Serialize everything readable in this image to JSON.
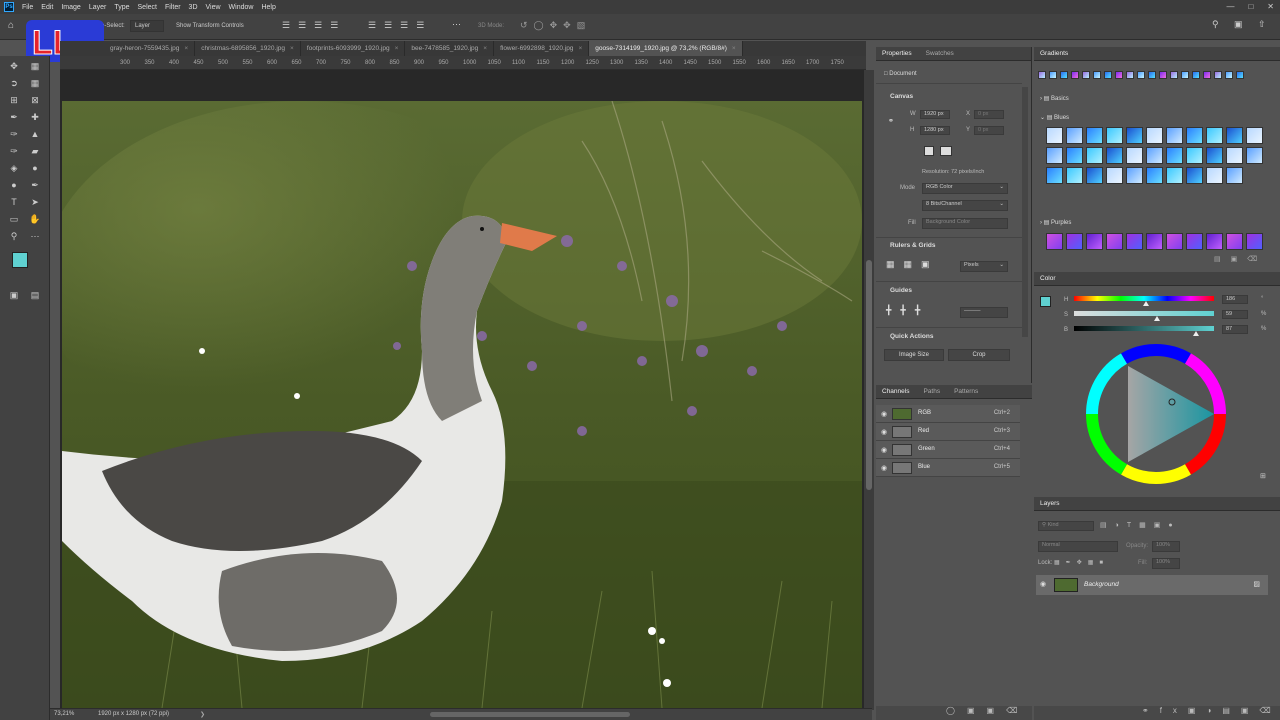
{
  "menubar": {
    "app_badge": "Ps",
    "items": [
      "File",
      "Edit",
      "Image",
      "Layer",
      "Type",
      "Select",
      "Filter",
      "3D",
      "View",
      "Window",
      "Help"
    ]
  },
  "options": {
    "auto_select": "Auto-Select:",
    "layer_dropdown": "Layer",
    "show_transform": "Show Transform Controls",
    "mode_3d": "3D Mode:"
  },
  "tabs": [
    {
      "label": "gray-heron-7559435.jpg"
    },
    {
      "label": "christmas-6895856_1920.jpg"
    },
    {
      "label": "footprints-6093999_1920.jpg"
    },
    {
      "label": "bee-7478585_1920.jpg"
    },
    {
      "label": "flower-6992898_1920.jpg"
    },
    {
      "label": "goose-7314199_1920.jpg @ 73,2% (RGB/8#)",
      "active": true
    }
  ],
  "ruler_ticks": [
    "300",
    "350",
    "400",
    "450",
    "500",
    "550",
    "600",
    "650",
    "700",
    "750",
    "800",
    "850",
    "900",
    "950",
    "1000",
    "1050",
    "1100",
    "1150",
    "1200",
    "1250",
    "1300",
    "1350",
    "1400",
    "1450",
    "1500",
    "1550",
    "1600",
    "1650",
    "1700",
    "1750"
  ],
  "status": {
    "zoom": "73,21%",
    "doc_size": "1920 px x 1280 px (72 ppi)"
  },
  "colors": {
    "foreground": "#5fd1d1",
    "background": "#e6f05a",
    "accent": "#31a8ff"
  },
  "properties": {
    "tab_properties": "Properties",
    "tab_swatches": "Swatches",
    "document_label": "Document",
    "canvas_title": "Canvas",
    "w_label": "W",
    "w_value": "1920 px",
    "h_label": "H",
    "h_value": "1280 px",
    "x_label": "X",
    "x_value": "0 px",
    "y_label": "Y",
    "y_value": "0 px",
    "resolution": "Resolution: 72 pixels/inch",
    "mode_label": "Mode",
    "mode_value": "RGB Color",
    "bits_value": "8 Bits/Channel",
    "fill_label": "Fill",
    "fill_value": "Background Color",
    "rulers_title": "Rulers & Grids",
    "units_value": "Pixels",
    "guides_title": "Guides",
    "quick_title": "Quick Actions",
    "image_size_btn": "Image Size",
    "crop_btn": "Crop"
  },
  "channels": {
    "tab_channels": "Channels",
    "tab_paths": "Paths",
    "tab_patterns": "Patterns",
    "rows": [
      {
        "name": "RGB",
        "shortcut": "Ctrl+2"
      },
      {
        "name": "Red",
        "shortcut": "Ctrl+3"
      },
      {
        "name": "Green",
        "shortcut": "Ctrl+4"
      },
      {
        "name": "Blue",
        "shortcut": "Ctrl+5"
      }
    ]
  },
  "gradients": {
    "title": "Gradients",
    "group_basics": "Basics",
    "group_blues": "Blues",
    "group_purples": "Purples"
  },
  "color_panel": {
    "title": "Color",
    "h_label": "H",
    "h_value": "186",
    "h_unit": "°",
    "s_label": "S",
    "s_value": "59",
    "s_unit": "%",
    "b_label": "B",
    "b_value": "87",
    "b_unit": "%"
  },
  "layers": {
    "title": "Layers",
    "kind_placeholder": "Kind",
    "blend_mode": "Normal",
    "opacity_label": "Opacity:",
    "opacity_value": "100%",
    "lock_label": "Lock:",
    "fill_label": "Fill:",
    "fill_value": "100%",
    "layer_name": "Background"
  }
}
